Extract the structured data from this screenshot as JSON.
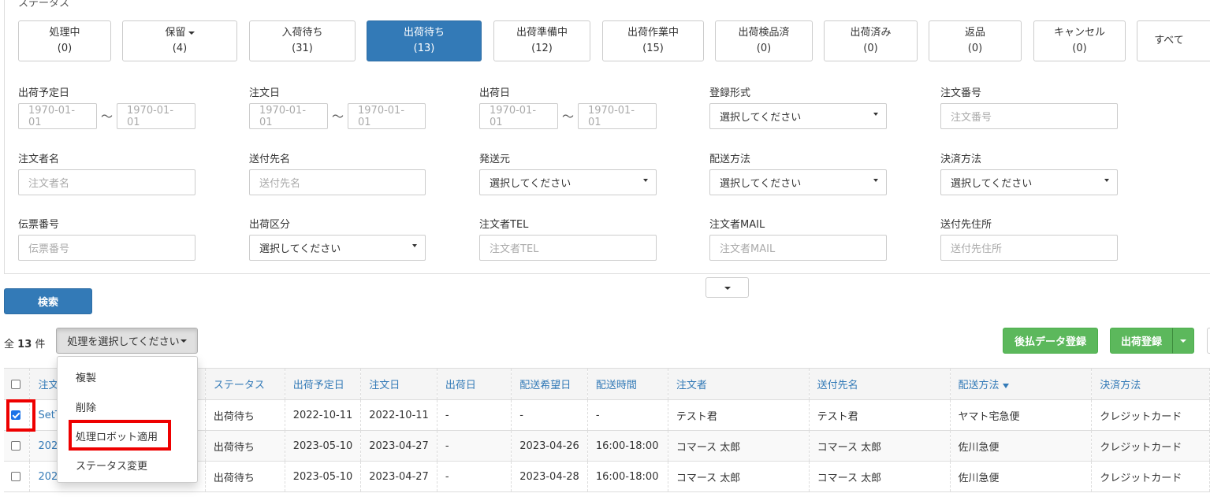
{
  "status_section": {
    "title": "ステータス",
    "buttons": [
      {
        "label": "処理中",
        "count": "(0)"
      },
      {
        "label": "保留",
        "count": "(4)"
      },
      {
        "label": "入荷待ち",
        "count": "(31)"
      },
      {
        "label": "出荷待ち",
        "count": "(13)"
      },
      {
        "label": "出荷準備中",
        "count": "(12)"
      },
      {
        "label": "出荷作業中",
        "count": "(15)"
      },
      {
        "label": "出荷検品済",
        "count": "(0)"
      },
      {
        "label": "出荷済み",
        "count": "(0)"
      },
      {
        "label": "返品",
        "count": "(0)"
      },
      {
        "label": "キャンセル",
        "count": "(0)"
      },
      {
        "label": "すべて",
        "count": ""
      }
    ]
  },
  "filters": {
    "ship_scheduled": {
      "label": "出荷予定日",
      "from": "1970-01-01",
      "to": "1970-01-01"
    },
    "order_date": {
      "label": "注文日",
      "from": "1970-01-01",
      "to": "1970-01-01"
    },
    "ship_date": {
      "label": "出荷日",
      "from": "1970-01-01",
      "to": "1970-01-01"
    },
    "registration_type": {
      "label": "登録形式",
      "value": "選択してください"
    },
    "order_number": {
      "label": "注文番号",
      "placeholder": "注文番号"
    },
    "orderer_name": {
      "label": "注文者名",
      "placeholder": "注文者名"
    },
    "recipient_name": {
      "label": "送付先名",
      "placeholder": "送付先名"
    },
    "ship_from": {
      "label": "発送元",
      "value": "選択してください"
    },
    "delivery_method": {
      "label": "配送方法",
      "value": "選択してください"
    },
    "payment_method": {
      "label": "決済方法",
      "value": "選択してください"
    },
    "slip_number": {
      "label": "伝票番号",
      "placeholder": "伝票番号"
    },
    "ship_category": {
      "label": "出荷区分",
      "value": "選択してください"
    },
    "orderer_tel": {
      "label": "注文者TEL",
      "placeholder": "注文者TEL"
    },
    "orderer_mail": {
      "label": "注文者MAIL",
      "placeholder": "注文者MAIL"
    },
    "recipient_address": {
      "label": "送付先住所",
      "placeholder": "送付先住所"
    }
  },
  "toolbar": {
    "search_label": "検索",
    "count_prefix": "全",
    "count_value": "13",
    "count_suffix": "件",
    "action_select_label": "処理を選択してください",
    "deferred_payment_label": "後払データ登録",
    "shipment_register_label": "出荷登録"
  },
  "action_menu": {
    "items": [
      "複製",
      "削除",
      "処理ロボット適用",
      "ステータス変更"
    ]
  },
  "table": {
    "headers": [
      "注文",
      "ステータス",
      "出荷予定日",
      "注文日",
      "出荷日",
      "配送希望日",
      "配送時間",
      "注文者",
      "送付先名",
      "配送方法",
      "決済方法"
    ],
    "rows": [
      {
        "id": "SetT",
        "status": "出荷待ち",
        "ship_scheduled": "2022-10-11",
        "order_date": "2022-10-11",
        "ship_date": "-",
        "wish_date": "-",
        "wish_time": "-",
        "orderer": "テスト君",
        "recipient": "テスト君",
        "delivery": "ヤマト宅急便",
        "payment": "クレジットカード",
        "checked": true
      },
      {
        "id": "2023",
        "status": "出荷待ち",
        "ship_scheduled": "2023-05-10",
        "order_date": "2023-04-27",
        "ship_date": "-",
        "wish_date": "2023-04-26",
        "wish_time": "16:00-18:00",
        "orderer": "コマース 太郎",
        "recipient": "コマース 太郎",
        "delivery": "佐川急便",
        "payment": "クレジットカード",
        "checked": false
      },
      {
        "id": "2023",
        "status": "出荷待ち",
        "ship_scheduled": "2023-05-10",
        "order_date": "2023-04-27",
        "ship_date": "-",
        "wish_date": "2023-04-28",
        "wish_time": "16:00-18:00",
        "orderer": "コマース 太郎",
        "recipient": "コマース 太郎",
        "delivery": "佐川急便",
        "payment": "クレジットカード",
        "checked": false
      }
    ]
  },
  "colors": {
    "primary": "#337ab7",
    "success": "#5cb85c",
    "highlight": "#e00000"
  }
}
